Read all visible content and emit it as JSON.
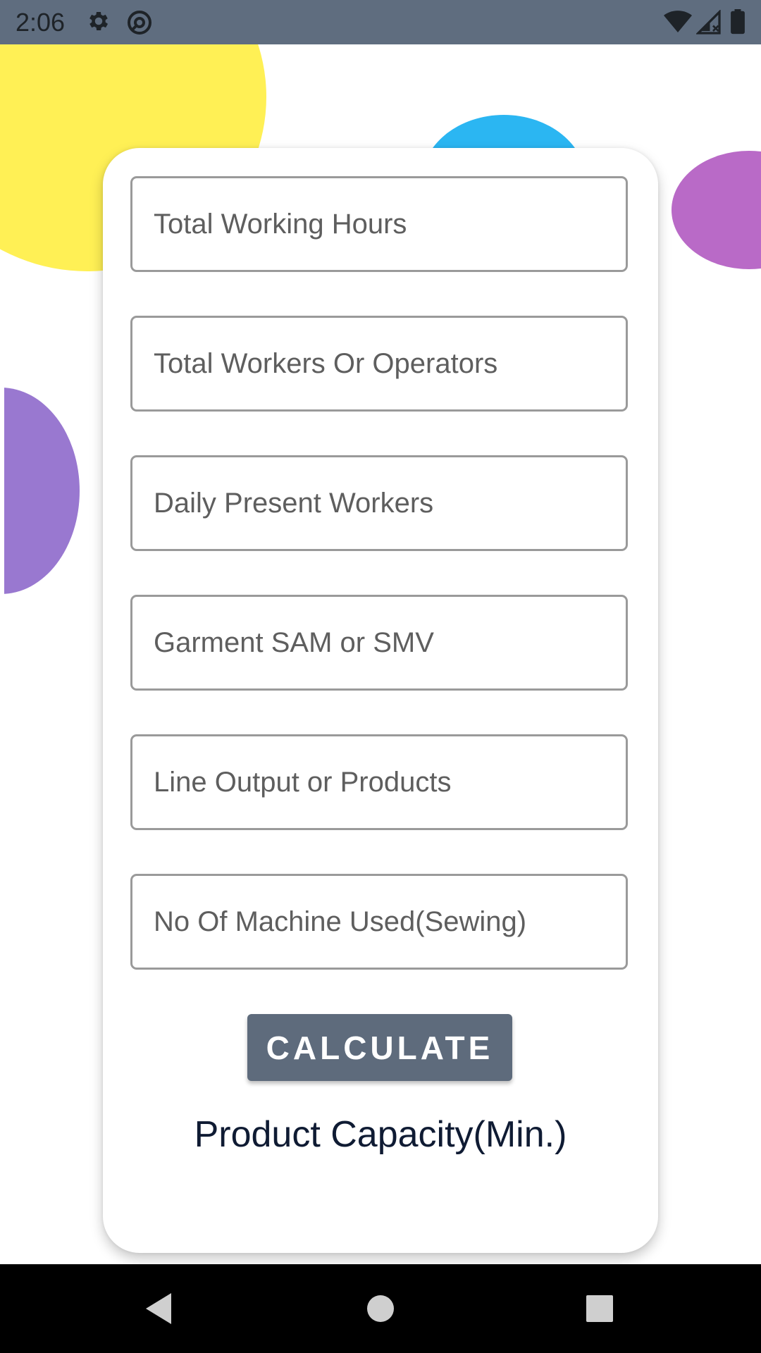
{
  "status_bar": {
    "time": "2:06",
    "icons": [
      "gear-icon",
      "at-sign-icon",
      "wifi-icon",
      "signal-icon",
      "battery-icon"
    ],
    "background": "#5f6d7f"
  },
  "form": {
    "fields": [
      {
        "placeholder": "Total Working Hours",
        "value": ""
      },
      {
        "placeholder": "Total Workers Or Operators",
        "value": ""
      },
      {
        "placeholder": "Daily Present Workers",
        "value": ""
      },
      {
        "placeholder": "Garment SAM or SMV",
        "value": ""
      },
      {
        "placeholder": "Line Output or Products",
        "value": ""
      },
      {
        "placeholder": "No Of Machine Used(Sewing)",
        "value": ""
      }
    ],
    "calculate_label": "CALCULATE",
    "result_label": "Product Capacity(Min.)"
  },
  "nav_bar": {
    "icons": [
      "back-icon",
      "home-icon",
      "recents-icon"
    ]
  },
  "colors": {
    "button": "#5e6b7c",
    "result_text": "#0f1b33",
    "blob_yellow": "#fff055",
    "blob_blue": "#2bb6f2",
    "blob_magenta": "#b96ac7",
    "blob_purple": "#9978d0"
  }
}
